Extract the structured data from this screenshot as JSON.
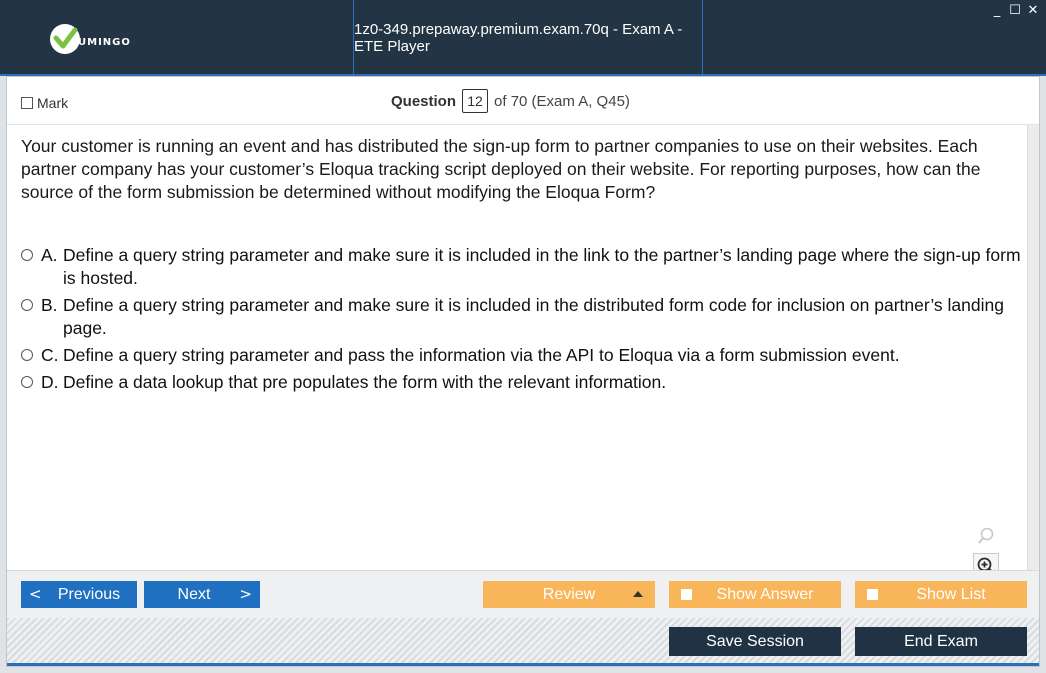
{
  "app": {
    "logo_text": "UMINGO",
    "title": "1z0-349.prepaway.premium.exam.70q - Exam A - ETE Player",
    "window_controls": [
      "_",
      "☐",
      "✕"
    ]
  },
  "header": {
    "mark_label": "Mark",
    "question_label": "Question",
    "question_number": "12",
    "question_of": "of 70 (Exam A, Q45)"
  },
  "question": {
    "text": "Your customer is running an event and has distributed the sign-up form to partner companies to use on their websites. Each partner company has your customer’s Eloqua tracking script deployed on their website. For reporting purposes, how can the source of the form submission be determined without modifying the Eloqua Form?",
    "options": [
      {
        "letter": "A.",
        "text": "Define a query string parameter and make sure it is included in the link to the partner’s landing page where the sign-up form is hosted."
      },
      {
        "letter": "B.",
        "text": "Define a query string parameter and make sure it is included in the distributed form code for inclusion on partner’s landing page."
      },
      {
        "letter": "C.",
        "text": "Define a query string parameter and pass the information via the API to Eloqua via a form submission event."
      },
      {
        "letter": "D.",
        "text": "Define a data lookup that pre populates the form with the relevant information."
      }
    ]
  },
  "nav": {
    "previous": "Previous",
    "next": "Next",
    "review": "Review",
    "show_answer": "Show Answer",
    "show_list": "Show List",
    "prev_arrow": "<",
    "next_arrow": ">"
  },
  "footer": {
    "save_session": "Save Session",
    "end_exam": "End Exam"
  },
  "colors": {
    "titlebar": "#233444",
    "accent_blue": "#1f70c1",
    "orange": "#f9b55a",
    "dark_button": "#1f3344",
    "logo_green": "#7cc242"
  },
  "icons": {
    "search": "magnifier-icon",
    "zoom_in": "zoom-in-icon",
    "zoom_out": "zoom-out-icon"
  }
}
